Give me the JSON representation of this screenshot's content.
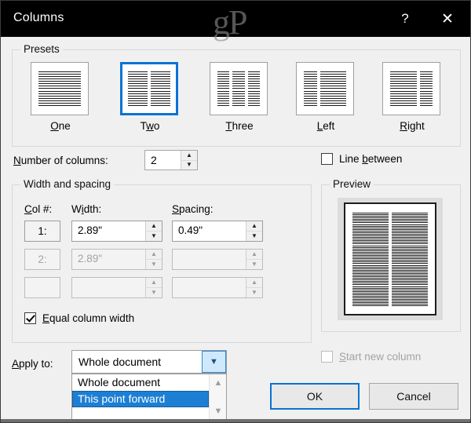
{
  "window": {
    "title": "Columns",
    "help_icon": "question-mark-icon",
    "close_icon": "close-icon",
    "watermark": "gP",
    "titlebar_color": "#000000",
    "accent_color": "#0a72d4",
    "selection_color": "#1c7fd4"
  },
  "presets": {
    "group_label": "Presets",
    "selected": "Two",
    "items": [
      {
        "label": "One",
        "accel": "O",
        "layout": [
          1.0
        ]
      },
      {
        "label": "Two",
        "accel": "w",
        "layout": [
          0.5,
          0.5
        ]
      },
      {
        "label": "Three",
        "accel": "T",
        "layout": [
          0.33,
          0.33,
          0.33
        ]
      },
      {
        "label": "Left",
        "accel": "L",
        "layout": [
          0.33,
          0.67
        ]
      },
      {
        "label": "Right",
        "accel": "R",
        "layout": [
          0.67,
          0.33
        ]
      }
    ]
  },
  "number_of_columns": {
    "label": "Number of columns:",
    "accel": "N",
    "value": "2",
    "spin_up_icon": "caret-up-icon",
    "spin_down_icon": "caret-down-icon"
  },
  "line_between": {
    "label": "Line between",
    "accel": "b",
    "checked": false,
    "enabled": true
  },
  "width_and_spacing": {
    "group_label": "Width and spacing",
    "headers": {
      "col": "Col #:",
      "col_accel": "C",
      "width": "Width:",
      "width_accel": "i",
      "spacing": "Spacing:",
      "spacing_accel": "S"
    },
    "rows": [
      {
        "col": "1:",
        "width": "2.89\"",
        "spacing": "0.49\"",
        "enabled": true
      },
      {
        "col": "2:",
        "width": "2.89\"",
        "spacing": "",
        "enabled": false
      },
      {
        "col": "",
        "width": "",
        "spacing": "",
        "enabled": false
      }
    ]
  },
  "equal_column_width": {
    "label": "Equal column width",
    "accel": "E",
    "checked": true,
    "enabled": true
  },
  "preview": {
    "group_label": "Preview",
    "columns": 2
  },
  "start_new_column": {
    "label": "Start new column",
    "accel": "S",
    "checked": false,
    "enabled": false
  },
  "apply_to": {
    "label": "Apply to:",
    "accel": "A",
    "value": "Whole document",
    "expanded": true,
    "dropdown_icon": "chevron-down-icon",
    "options": [
      {
        "label": "Whole document",
        "selected": false
      },
      {
        "label": "This point forward",
        "selected": true
      }
    ],
    "scroll_up_icon": "chevron-up-icon",
    "scroll_down_icon": "chevron-down-icon"
  },
  "buttons": {
    "ok": "OK",
    "cancel": "Cancel",
    "default": "OK"
  }
}
